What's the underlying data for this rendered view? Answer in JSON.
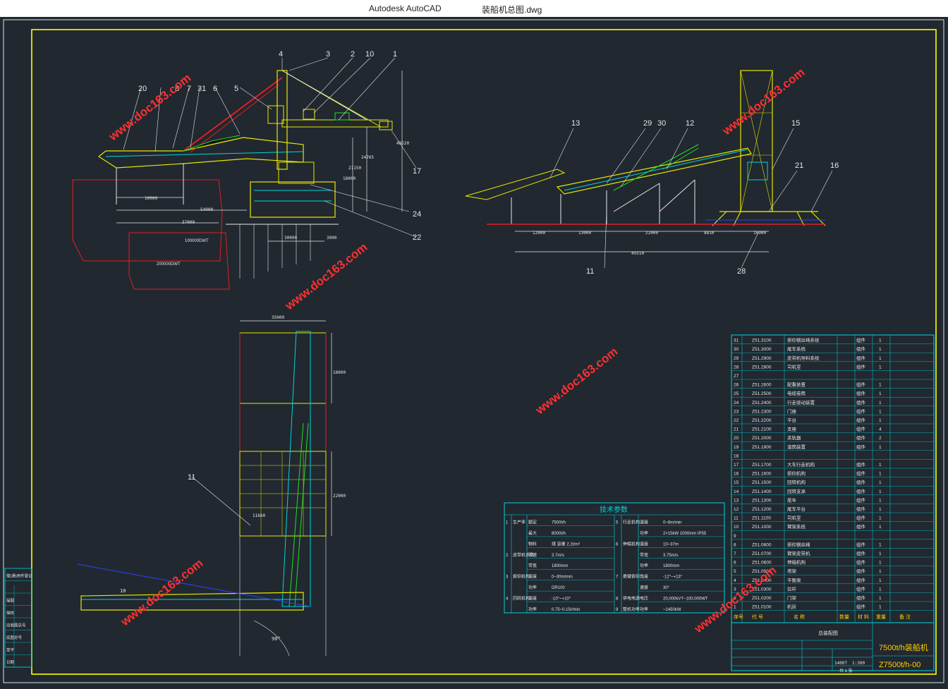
{
  "window": {
    "app_name": "Autodesk AutoCAD",
    "file_name": "装船机总图.dwg"
  },
  "callouts": [
    "1",
    "2",
    "3",
    "4",
    "5",
    "6",
    "7",
    "8",
    "10",
    "12",
    "13",
    "15",
    "16",
    "17",
    "19",
    "20",
    "21",
    "22",
    "24",
    "28",
    "29",
    "30",
    "31",
    "11"
  ],
  "watermarks": [
    "www.doc163.com"
  ],
  "dims_left": [
    "10000",
    "54000",
    "37000",
    "30000",
    "3000",
    "18000",
    "21150",
    "24765",
    "48520"
  ],
  "dims_right": [
    "12000",
    "13000",
    "22000",
    "8810",
    "16000",
    "45510",
    "12000"
  ],
  "dims_plan": [
    "35000",
    "18000",
    "22000",
    "11660",
    "10",
    "90°"
  ],
  "vessel_labels": [
    "100000DWT",
    "200000DWT"
  ],
  "tech_table": {
    "title": "技术参数",
    "rows": [
      [
        "1",
        "生产率",
        "额定",
        "7500t/h"
      ],
      [
        "",
        "",
        "最大",
        "8000t/h"
      ],
      [
        "",
        "",
        "物料",
        "煤  容重 2.2t/m³"
      ],
      [
        "2",
        "皮带机系统",
        "带速",
        "3.7m/s"
      ],
      [
        "",
        "",
        "带宽",
        "1800mm"
      ],
      [
        "3",
        "俯仰机构",
        "速度",
        "0~30m/min"
      ],
      [
        "",
        "",
        "功率",
        "DR100"
      ],
      [
        "4",
        "回转机构",
        "速度",
        "-10°~+10°"
      ],
      [
        "",
        "",
        "功率",
        "0.75~0.15r/min"
      ]
    ],
    "rows_right": [
      [
        "5",
        "行走机构",
        "速度",
        "0~6m/min"
      ],
      [
        "",
        "",
        "功率",
        "2×15kW 1000mm IP55"
      ],
      [
        "6",
        "伸缩机构",
        "速度",
        "10~37m"
      ],
      [
        "",
        "",
        "带宽",
        "3.75m/s"
      ],
      [
        "",
        "",
        "功率",
        "1800mm"
      ],
      [
        "7",
        "悬臂俯仰",
        "角度",
        "-12°~+13°"
      ],
      [
        "",
        "",
        "速度",
        "30°"
      ],
      [
        "8",
        "供电电源",
        "电压",
        "20,000kVT~100,000WT"
      ],
      [
        "9",
        "整机功率",
        "功率",
        "~1450kW"
      ]
    ]
  },
  "parts_table": {
    "headers": [
      "序号",
      "代 号",
      "名 称",
      "数量",
      "材 料",
      "重量",
      "备 注"
    ],
    "rows": [
      [
        "31",
        "Z51.3100",
        "俯仰钢丝绳系统",
        "组件",
        "1"
      ],
      [
        "30",
        "Z51.3000",
        "尾车系统",
        "组件",
        "1"
      ],
      [
        "29",
        "Z51.2900",
        "皮带机导料系统",
        "组件",
        "1"
      ],
      [
        "28",
        "Z51.2800",
        "司机室",
        "组件",
        "1"
      ],
      [
        "27",
        "",
        "",
        "",
        ""
      ],
      [
        "26",
        "Z51.2600",
        "配重装置",
        "组件",
        "1"
      ],
      [
        "25",
        "Z51.2500",
        "电缆卷筒",
        "组件",
        "1"
      ],
      [
        "24",
        "Z51.2400",
        "行走驱动装置",
        "组件",
        "1"
      ],
      [
        "23",
        "Z51.2300",
        "门座",
        "组件",
        "1"
      ],
      [
        "22",
        "Z51.2200",
        "平台",
        "组件",
        "1"
      ],
      [
        "21",
        "Z51.2100",
        "支座",
        "组件",
        "4"
      ],
      [
        "20",
        "Z51.2000",
        "夹轨器",
        "组件",
        "2"
      ],
      [
        "19",
        "Z51.1900",
        "溜筒装置",
        "组件",
        "1"
      ],
      [
        "18",
        "",
        "",
        "",
        ""
      ],
      [
        "17",
        "Z51.1700",
        "大车行走机构",
        "组件",
        "1"
      ],
      [
        "16",
        "Z51.1600",
        "俯仰机构",
        "组件",
        "1"
      ],
      [
        "15",
        "Z51.1500",
        "回转机构",
        "组件",
        "1"
      ],
      [
        "14",
        "Z51.1400",
        "回转支承",
        "组件",
        "1"
      ],
      [
        "13",
        "Z51.1300",
        "尾车",
        "组件",
        "1"
      ],
      [
        "12",
        "Z51.1200",
        "尾车平台",
        "组件",
        "1"
      ],
      [
        "11",
        "Z51.1100",
        "司机室",
        "组件",
        "1"
      ],
      [
        "10",
        "Z51.1000",
        "臂架系统",
        "组件",
        "1"
      ],
      [
        "9",
        "",
        "",
        "",
        ""
      ],
      [
        "8",
        "Z51.0800",
        "俯仰钢丝绳",
        "组件",
        "1"
      ],
      [
        "7",
        "Z51.0700",
        "臂架皮带机",
        "组件",
        "1"
      ],
      [
        "6",
        "Z51.0600",
        "伸缩机构",
        "组件",
        "1"
      ],
      [
        "5",
        "Z51.0500",
        "塔架",
        "组件",
        "1"
      ],
      [
        "4",
        "Z51.0400",
        "平衡梁",
        "组件",
        "1"
      ],
      [
        "3",
        "Z51.0300",
        "拉杆",
        "组件",
        "1"
      ],
      [
        "2",
        "Z51.0200",
        "门架",
        "组件",
        "1"
      ],
      [
        "1",
        "Z51.0100",
        "机房",
        "组件",
        "1"
      ]
    ]
  },
  "title_block": {
    "name_cn": "总装配图",
    "product": "7500t/h装船机",
    "drawing_no": "Z7500t/h-00",
    "weight": "1400T",
    "scale": "1:300",
    "sheet": "共 1 张",
    "row_labels": [
      "标记",
      "处数",
      "分区",
      "更改文件号",
      "签名",
      "年月日"
    ],
    "role_labels": [
      "设计",
      "标准化",
      "审核",
      "工艺",
      "批准",
      "阶段标记",
      "重量",
      "比例"
    ]
  },
  "revision_block": {
    "labels": [
      "借(通)用件登记",
      "",
      "描图",
      "描校",
      "旧底图总号",
      "底图总号",
      "签字",
      "日期"
    ]
  },
  "colors": {
    "background": "#212830",
    "frame": "#ffff00",
    "cyan": "#00d5dd",
    "red": "#e02020",
    "green": "#20e020",
    "blue": "#3040ff",
    "white": "#e6e6e6",
    "magenta": "#ff40ff"
  }
}
